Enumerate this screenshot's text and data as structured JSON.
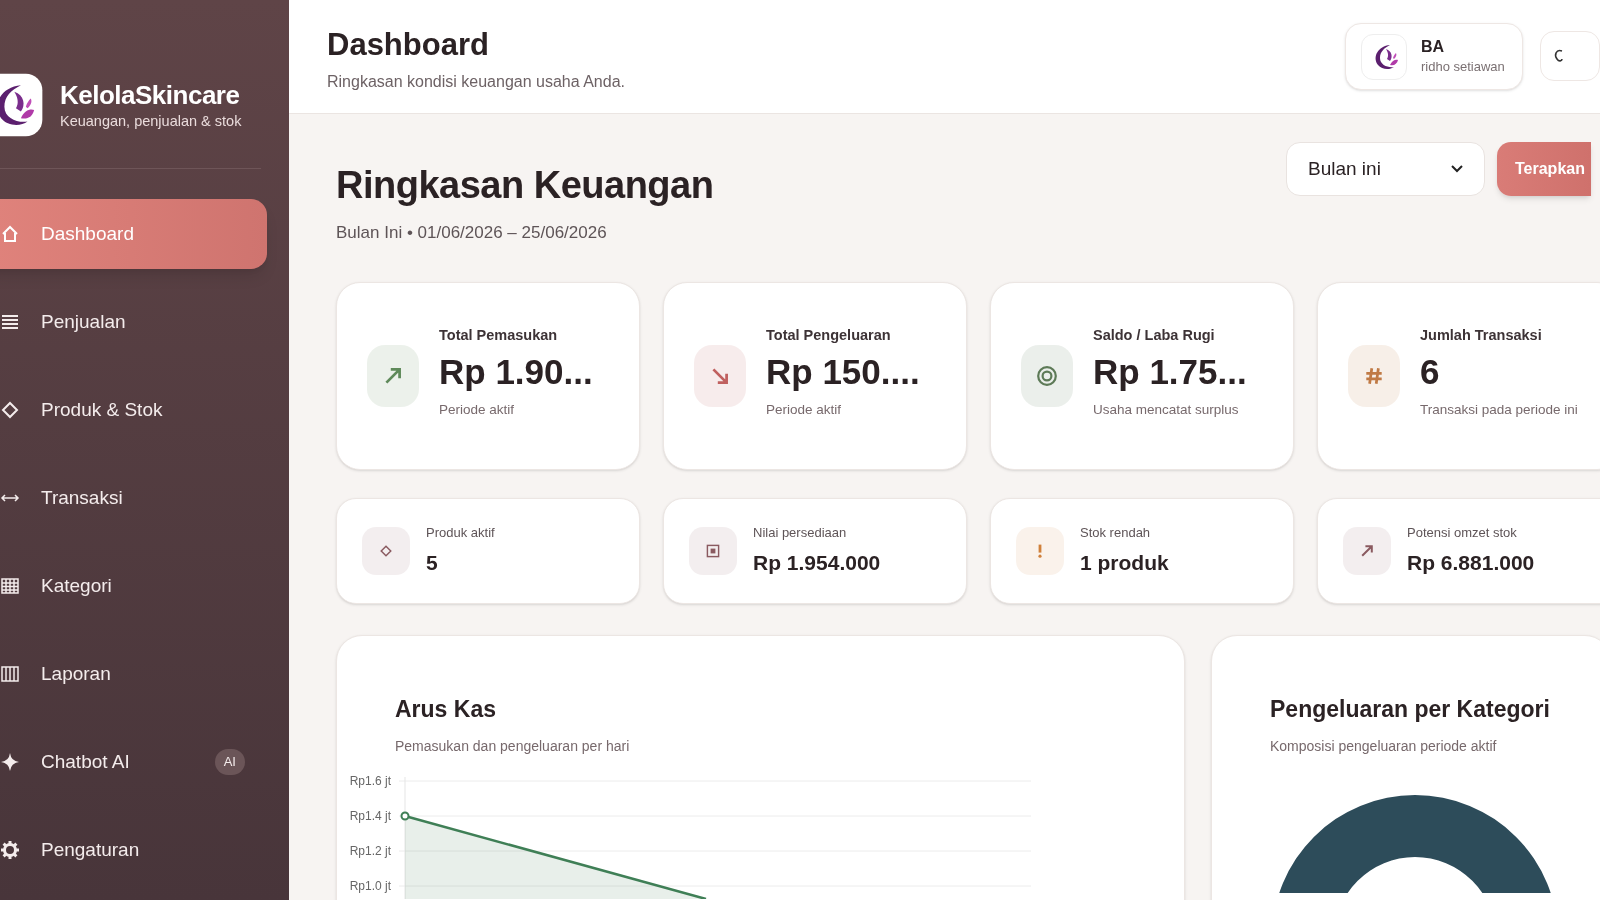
{
  "sidebar": {
    "brand": {
      "name": "KelolaSkincare",
      "tagline": "Keuangan, penjualan & stok"
    },
    "items": [
      {
        "label": "Dashboard",
        "kind": "home",
        "selected": true
      },
      {
        "label": "Penjualan",
        "kind": "list",
        "selected": false
      },
      {
        "label": "Produk & Stok",
        "kind": "diamond",
        "selected": false
      },
      {
        "label": "Transaksi",
        "kind": "arrows",
        "selected": false
      },
      {
        "label": "Kategori",
        "kind": "grid",
        "selected": false
      },
      {
        "label": "Laporan",
        "kind": "bars",
        "selected": false
      },
      {
        "label": "Chatbot AI",
        "kind": "sparkle",
        "selected": false,
        "badge": "AI"
      },
      {
        "label": "Pengaturan",
        "kind": "gear",
        "selected": false
      }
    ]
  },
  "header": {
    "title": "Dashboard",
    "subtitle": "Ringkasan kondisi keuangan usaha Anda.",
    "user": {
      "initials": "BA",
      "name": "ridho setiawan"
    }
  },
  "summary": {
    "title": "Ringkasan Keuangan",
    "period": "Bulan Ini • 01/06/2026 – 25/06/2026",
    "filter": {
      "value": "Bulan ini"
    },
    "apply_button": "Terapkan"
  },
  "stats": [
    {
      "label": "Total Pemasukan",
      "value": "Rp 1.90...",
      "note": "Periode aktif",
      "kind": "up",
      "color": "#5f8a5a"
    },
    {
      "label": "Total Pengeluaran",
      "value": "Rp 150....",
      "note": "Periode aktif",
      "kind": "down",
      "color": "#c0605f"
    },
    {
      "label": "Saldo / Laba Rugi",
      "value": "Rp 1.75...",
      "note": "Usaha mencatat surplus",
      "kind": "target",
      "color": "#5d7a57"
    },
    {
      "label": "Jumlah Transaksi",
      "value": "6",
      "note": "Transaksi pada periode ini",
      "kind": "hash",
      "color": "#c07a45"
    }
  ],
  "mini_stats": [
    {
      "label": "Produk aktif",
      "value": "5",
      "kind": "diamond",
      "color": "#8a5a60"
    },
    {
      "label": "Nilai persediaan",
      "value": "Rp 1.954.000",
      "kind": "box",
      "color": "#8a5a60"
    },
    {
      "label": "Stok rendah",
      "value": "1 produk",
      "kind": "alert",
      "color": "#d0803a"
    },
    {
      "label": "Potensi omzet stok",
      "value": "Rp 6.881.000",
      "kind": "up",
      "color": "#8a5a60"
    }
  ],
  "cashflow": {
    "title": "Arus Kas",
    "subtitle": "Pemasukan dan pengeluaran per hari",
    "y_axis_labels": [
      "Rp1.6 jt",
      "Rp1.4 jt",
      "Rp1.2 jt",
      "Rp1.0 jt"
    ]
  },
  "expense_by_category": {
    "title": "Pengeluaran per Kategori",
    "subtitle": "Komposisi pengeluaran periode aktif"
  }
}
